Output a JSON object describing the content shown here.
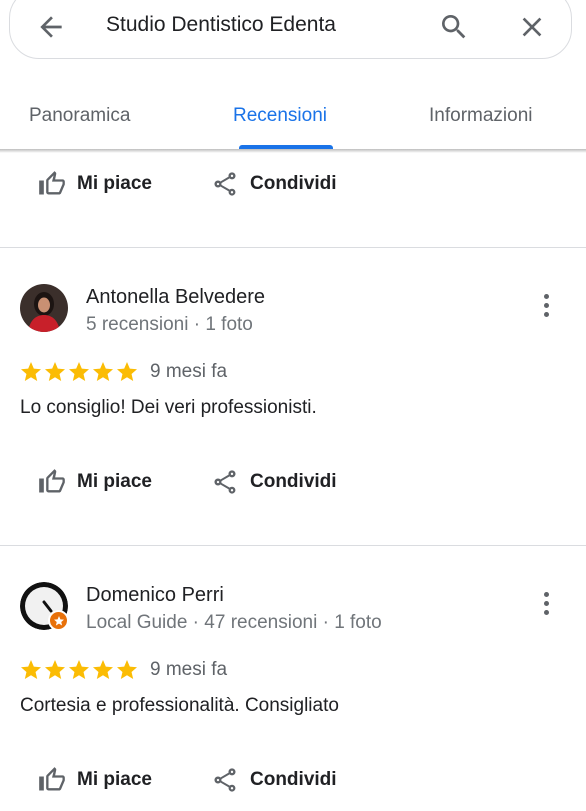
{
  "search": {
    "query": "Studio Dentistico Edenta"
  },
  "tabs": [
    {
      "label": "Panoramica",
      "active": false
    },
    {
      "label": "Recensioni",
      "active": true
    },
    {
      "label": "Informazioni",
      "active": false
    }
  ],
  "actions": {
    "like_label": "Mi piace",
    "share_label": "Condividi"
  },
  "reviews": [
    {
      "author": "Antonella Belvedere",
      "meta": "5 recensioni · 1 foto",
      "rating": 5,
      "time": "9 mesi fa",
      "text": "Lo consiglio! Dei veri professionisti.",
      "local_guide": false
    },
    {
      "author": "Domenico Perri",
      "meta": "Local Guide · 47 recensioni · 1 foto",
      "rating": 5,
      "time": "9 mesi fa",
      "text": "Cortesia e professionalità. Consigliato",
      "local_guide": true
    }
  ],
  "colors": {
    "accent": "#1a73e8",
    "star": "#fbbc04",
    "local_guide_badge": "#e8710a"
  }
}
